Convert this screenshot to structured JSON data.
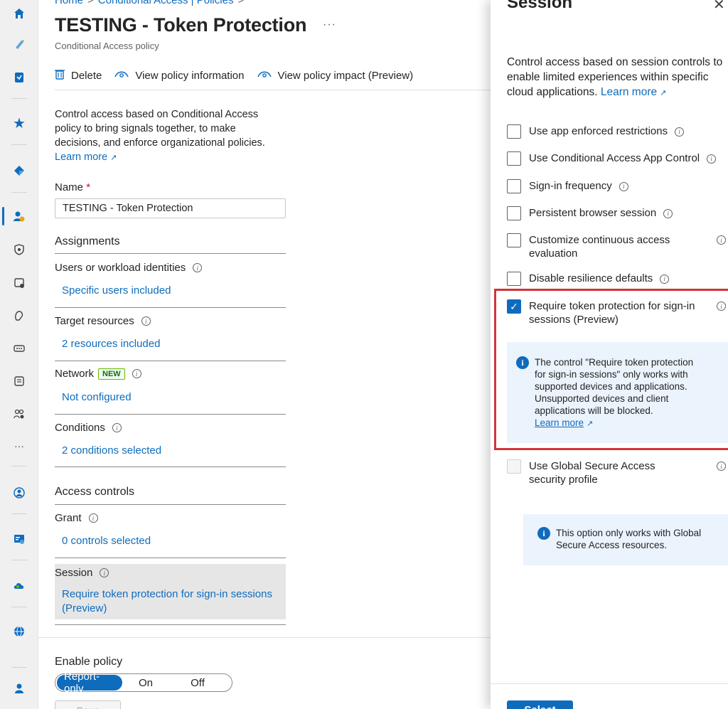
{
  "breadcrumb": {
    "home": "Home",
    "ca": "Conditional Access | Policies",
    "sep": ">"
  },
  "page": {
    "title": "TESTING - Token Protection",
    "more": "···",
    "subtitle": "Conditional Access policy"
  },
  "toolbar": {
    "delete": "Delete",
    "view_info": "View policy information",
    "view_impact": "View policy impact (Preview)"
  },
  "intro": {
    "text": "Control access based on Conditional Access policy to bring signals together, to make decisions, and enforce organizational policies.",
    "learn_more": "Learn more"
  },
  "name_field": {
    "label": "Name",
    "required": "*",
    "value": "TESTING - Token Protection"
  },
  "assignments": {
    "heading": "Assignments",
    "users_label": "Users or workload identities",
    "users_value": "Specific users included",
    "targets_label": "Target resources",
    "targets_value": "2 resources included",
    "network_label": "Network",
    "network_badge": "NEW",
    "network_value": "Not configured",
    "conditions_label": "Conditions",
    "conditions_value": "2 conditions selected"
  },
  "access_controls": {
    "heading": "Access controls",
    "grant_label": "Grant",
    "grant_value": "0 controls selected",
    "session_label": "Session",
    "session_value": "Require token protection for sign-in sessions (Preview)"
  },
  "enable_policy": {
    "label": "Enable policy",
    "options": [
      "Report-only",
      "On",
      "Off"
    ],
    "selected": "Report-only",
    "save": "Save"
  },
  "panel": {
    "title": "Session",
    "close": "✕",
    "desc": "Control access based on session controls to enable limited experiences within specific cloud applications.",
    "learn_more": "Learn more",
    "options": [
      {
        "label": "Use app enforced restrictions",
        "checked": false
      },
      {
        "label": "Use Conditional Access App Control",
        "checked": false
      },
      {
        "label": "Sign-in frequency",
        "checked": false
      },
      {
        "label": "Persistent browser session",
        "checked": false
      },
      {
        "label": "Customize continuous access evaluation",
        "checked": false
      },
      {
        "label": "Disable resilience defaults",
        "checked": false
      },
      {
        "label": "Require token protection for sign-in sessions (Preview)",
        "checked": true
      },
      {
        "label": "Use Global Secure Access security profile",
        "checked": false,
        "disabled": true
      }
    ],
    "token_msg": "The control \"Require token protection for sign-in sessions\" only works with supported devices and applications. Unsupported devices and client applications will be blocked.",
    "token_msg_link": "Learn more",
    "gsa_msg": "This option only works with Global Secure Access resources.",
    "select": "Select"
  },
  "colors": {
    "accent": "#0f6cbd",
    "highlight": "#d13438",
    "new_badge": "#6bb700"
  }
}
